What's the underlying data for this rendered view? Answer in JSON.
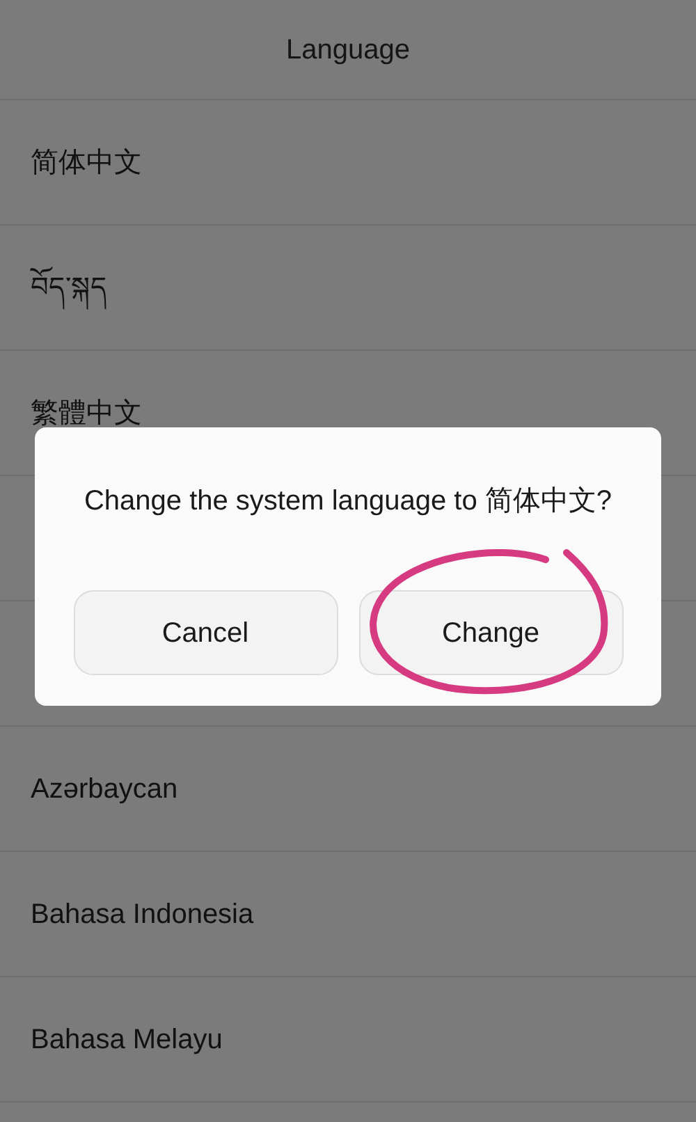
{
  "header": {
    "title": "Language"
  },
  "rows": [
    {
      "kind": "language",
      "label": "简体中文"
    },
    {
      "kind": "language",
      "label": "བོད་སྐད"
    },
    {
      "kind": "language",
      "label": "繁體中文"
    },
    {
      "kind": "covered"
    },
    {
      "kind": "covered"
    },
    {
      "kind": "language",
      "label": "Azərbaycan"
    },
    {
      "kind": "language",
      "label": "Bahasa Indonesia"
    },
    {
      "kind": "language",
      "label": "Bahasa Melayu"
    }
  ],
  "dialog": {
    "message": "Change the system language to 简体中文?",
    "buttons": [
      "Cancel",
      "Change"
    ]
  }
}
